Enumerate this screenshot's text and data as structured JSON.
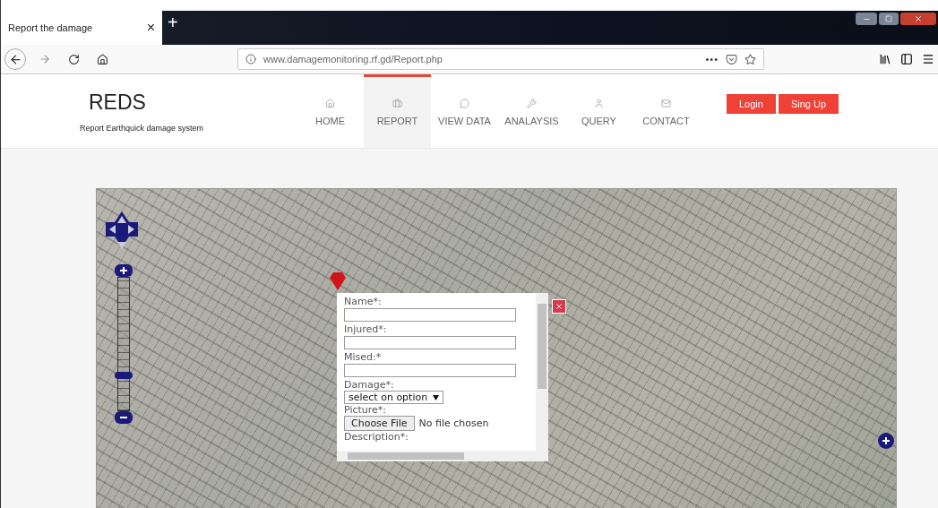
{
  "browser": {
    "tab": {
      "title": "Report the damage",
      "close": "×"
    },
    "new_tab": "+",
    "url": "www.damagemonitoring.rf.gd/Report.php",
    "page_actions": "•••"
  },
  "site": {
    "logo": "REDS",
    "tagline": "Report Earthquick damage system",
    "nav": [
      {
        "label": "HOME",
        "selected": false
      },
      {
        "label": "REPORT",
        "selected": true
      },
      {
        "label": "VIEW DATA",
        "selected": false
      },
      {
        "label": "ANALAYSIS",
        "selected": false
      },
      {
        "label": "QUERY",
        "selected": false
      },
      {
        "label": "CONTACT",
        "selected": false
      }
    ],
    "buttons": [
      "Login",
      "Sing Up"
    ]
  },
  "map": {
    "zoom": {
      "level": 0.25
    },
    "popup": {
      "fields": [
        {
          "kind": "text",
          "label": "Name*:"
        },
        {
          "kind": "text",
          "label": "Injured*:"
        },
        {
          "kind": "text",
          "label": "Mised:*"
        },
        {
          "kind": "select",
          "label": "Damage*:",
          "value": "select on option"
        },
        {
          "kind": "file",
          "label": "Picture*:",
          "button": "Choose File",
          "status": "No file chosen"
        },
        {
          "kind": "label",
          "label": "Description*:"
        }
      ]
    }
  }
}
